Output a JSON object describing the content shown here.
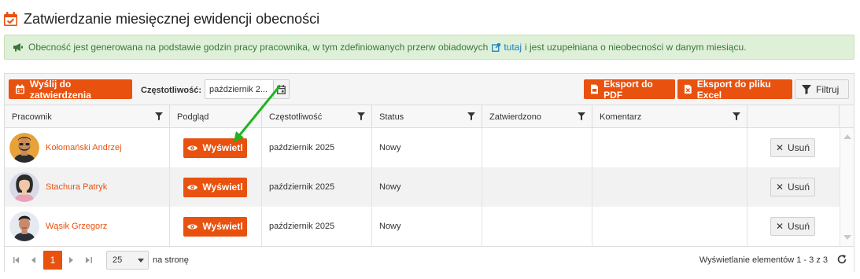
{
  "page": {
    "title": "Zatwierdzanie miesięcznej ewidencji obecności"
  },
  "info": {
    "text_before": "Obecność jest generowana na podstawie godzin pracy pracownika, w tym zdefiniowanych przerw obiadowych",
    "link_label": "tutaj",
    "text_after": "i jest uzupełniana o nieobecności w danym miesiącu."
  },
  "toolbar": {
    "send_label": "Wyślij do zatwierdzenia",
    "frequency_label": "Częstotliwość:",
    "frequency_value": "październik 2...",
    "export_pdf_label": "Eksport do PDF",
    "export_excel_label": "Eksport do pliku Excel",
    "filter_label": "Filtruj"
  },
  "columns": [
    "Pracownik",
    "Podgląd",
    "Częstotliwość",
    "Status",
    "Zatwierdzono",
    "Komentarz"
  ],
  "rows": [
    {
      "employee": "Kołomański Andrzej",
      "view_label": "Wyświetl",
      "frequency": "październik 2025",
      "status": "Nowy",
      "approved": "",
      "comment": "",
      "delete_label": "Usuń",
      "avatar": "man-beard-avatar"
    },
    {
      "employee": "Stachura Patryk",
      "view_label": "Wyświetl",
      "frequency": "październik 2025",
      "status": "Nowy",
      "approved": "",
      "comment": "",
      "delete_label": "Usuń",
      "avatar": "long-hair-avatar"
    },
    {
      "employee": "Wąsik Grzegorz",
      "view_label": "Wyświetl",
      "frequency": "październik 2025",
      "status": "Nowy",
      "approved": "",
      "comment": "",
      "delete_label": "Usuń",
      "avatar": "man-short-hair-avatar"
    }
  ],
  "pager": {
    "current_page": "1",
    "page_size": "25",
    "per_page_label": "na stronę",
    "info": "Wyświetlanie elementów 1 - 3 z 3"
  },
  "colors": {
    "accent": "#e8510e",
    "info_bg": "#dff0d8",
    "info_text": "#3c763d",
    "link": "#1a7fc1",
    "annotation_arrow": "#22b322"
  }
}
